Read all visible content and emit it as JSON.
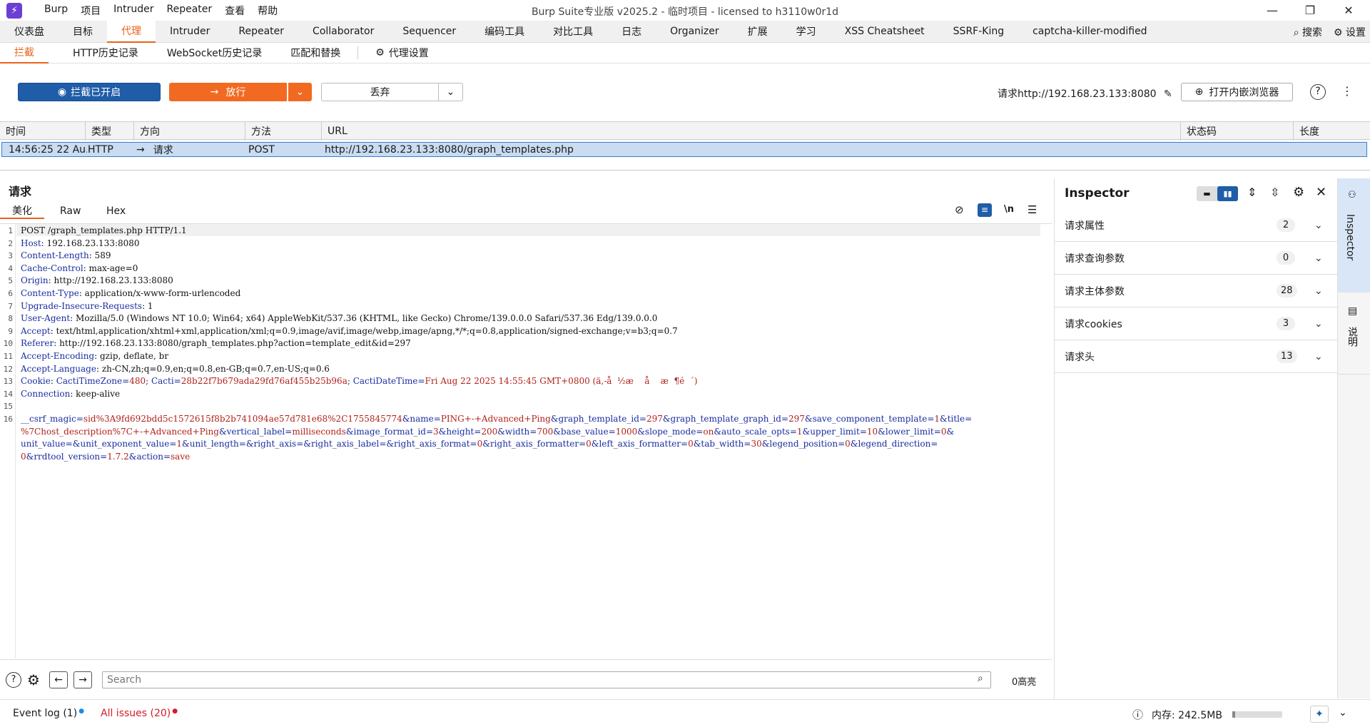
{
  "window": {
    "title": "Burp Suite专业版  v2025.2 - 临时项目 - licensed to h3110w0r1d",
    "menus": [
      "Burp",
      "项目",
      "Intruder",
      "Repeater",
      "查看",
      "帮助"
    ]
  },
  "main_tabs": [
    "仪表盘",
    "目标",
    "代理",
    "Intruder",
    "Repeater",
    "Collaborator",
    "Sequencer",
    "编码工具",
    "对比工具",
    "日志",
    "Organizer",
    "扩展",
    "学习",
    "XSS Cheatsheet",
    "SSRF-King",
    "captcha-killer-modified"
  ],
  "main_right": {
    "search_label": "搜索",
    "settings_label": "设置"
  },
  "sub_tabs": [
    "拦截",
    "HTTP历史记录",
    "WebSocket历史记录",
    "匹配和替换",
    "代理设置"
  ],
  "toolbar": {
    "intercept_label": "拦截已开启",
    "forward_label": "放行",
    "drop_label": "丢弃",
    "request_target": "请求http://192.168.23.133:8080",
    "browser_label": "打开内嵌浏览器"
  },
  "table": {
    "headers": [
      "时间",
      "类型",
      "方向",
      "方法",
      "URL",
      "状态码",
      "长度"
    ],
    "row": {
      "time": "14:56:25 22 Au...",
      "type": "HTTP",
      "direction": "请求",
      "method": "POST",
      "url": "http://192.168.23.133:8080/graph_templates.php"
    }
  },
  "request": {
    "title": "请求",
    "tabs": [
      "美化",
      "Raw",
      "Hex"
    ],
    "line1": "POST /graph_templates.php HTTP/1.1",
    "headers": [
      {
        "k": "Host",
        "v": " 192.168.23.133:8080"
      },
      {
        "k": "Content-Length",
        "v": " 589"
      },
      {
        "k": "Cache-Control",
        "v": " max-age=0"
      },
      {
        "k": "Origin",
        "v": " http://192.168.23.133:8080"
      },
      {
        "k": "Content-Type",
        "v": " application/x-www-form-urlencoded"
      },
      {
        "k": "Upgrade-Insecure-Requests",
        "v": " 1"
      },
      {
        "k": "User-Agent",
        "v": " Mozilla/5.0 (Windows NT 10.0; Win64; x64) AppleWebKit/537.36 (KHTML, like Gecko) Chrome/139.0.0.0 Safari/537.36 Edg/139.0.0.0"
      },
      {
        "k": "Accept",
        "v": " text/html,application/xhtml+xml,application/xml;q=0.9,image/avif,image/webp,image/apng,*/*;q=0.8,application/signed-exchange;v=b3;q=0.7"
      },
      {
        "k": "Referer",
        "v": " http://192.168.23.133:8080/graph_templates.php?action=template_edit&id=297"
      },
      {
        "k": "Accept-Encoding",
        "v": " gzip, deflate, br"
      },
      {
        "k": "Accept-Language",
        "v": " zh-CN,zh;q=0.9,en;q=0.8,en-GB;q=0.7,en-US;q=0.6"
      }
    ],
    "cookie": {
      "k": "Cookie",
      "a": " CactiTimeZone=",
      "av": "480",
      "b": "; Cacti=",
      "bv": "28b22f7b679ada29fd76af455b25b96a",
      "c": "; CactiDateTime=",
      "cv": "Fri Aug 22 2025 14:55:45 GMT+0800 (ä,-å  ½æ    å    æ  ¶é  ´)"
    },
    "connection": {
      "k": "Connection",
      "v": " keep-alive"
    },
    "body_lines": [
      [
        [
          "__csrf_magic",
          "sid%3A9fd692bdd5c1572615f8b2b741094ae57d781e68%2C1755845774"
        ],
        [
          "&name",
          "PING+-+Advanced+Ping"
        ],
        [
          "&graph_template_id",
          "297"
        ],
        [
          "&graph_template_graph_id",
          "297"
        ],
        [
          "&save_component_template",
          "1"
        ],
        [
          "&title",
          ""
        ]
      ],
      [
        [
          "",
          "%7Chost_description%7C+-+Advanced+Ping"
        ],
        [
          "&vertical_label",
          "milliseconds"
        ],
        [
          "&image_format_id",
          "3"
        ],
        [
          "&height",
          "200"
        ],
        [
          "&width",
          "700"
        ],
        [
          "&base_value",
          "1000"
        ],
        [
          "&slope_mode",
          "on"
        ],
        [
          "&auto_scale_opts",
          "1"
        ],
        [
          "&upper_limit",
          "10"
        ],
        [
          "&lower_limit",
          "0"
        ],
        [
          "&",
          null
        ]
      ],
      [
        [
          "unit_value",
          ""
        ],
        [
          "&unit_exponent_value",
          "1"
        ],
        [
          "&unit_length",
          ""
        ],
        [
          "&right_axis",
          ""
        ],
        [
          "&right_axis_label",
          ""
        ],
        [
          "&right_axis_format",
          "0"
        ],
        [
          "&right_axis_formatter",
          "0"
        ],
        [
          "&left_axis_formatter",
          "0"
        ],
        [
          "&tab_width",
          "30"
        ],
        [
          "&legend_position",
          "0"
        ],
        [
          "&legend_direction",
          ""
        ]
      ],
      [
        [
          "",
          "0"
        ],
        [
          "&rrdtool_version",
          "1.7.2"
        ],
        [
          "&action",
          "save"
        ]
      ]
    ]
  },
  "search": {
    "placeholder": "Search",
    "highlights": "0高亮"
  },
  "inspector": {
    "title": "Inspector",
    "rows": [
      {
        "label": "请求属性",
        "count": "2"
      },
      {
        "label": "请求查询参数",
        "count": "0"
      },
      {
        "label": "请求主体参数",
        "count": "28"
      },
      {
        "label": "请求cookies",
        "count": "3"
      },
      {
        "label": "请求头",
        "count": "13"
      }
    ],
    "side_tabs": [
      "Inspector",
      "说明"
    ]
  },
  "status": {
    "event_log": "Event log (1)",
    "issues": "All issues (20)",
    "memory": "内存: 242.5MB"
  },
  "colors": {
    "accent": "#e8631a",
    "intercept_blue": "#1f5da8",
    "forward_orange": "#f26a21",
    "selected_row": "#c9dcf1"
  }
}
